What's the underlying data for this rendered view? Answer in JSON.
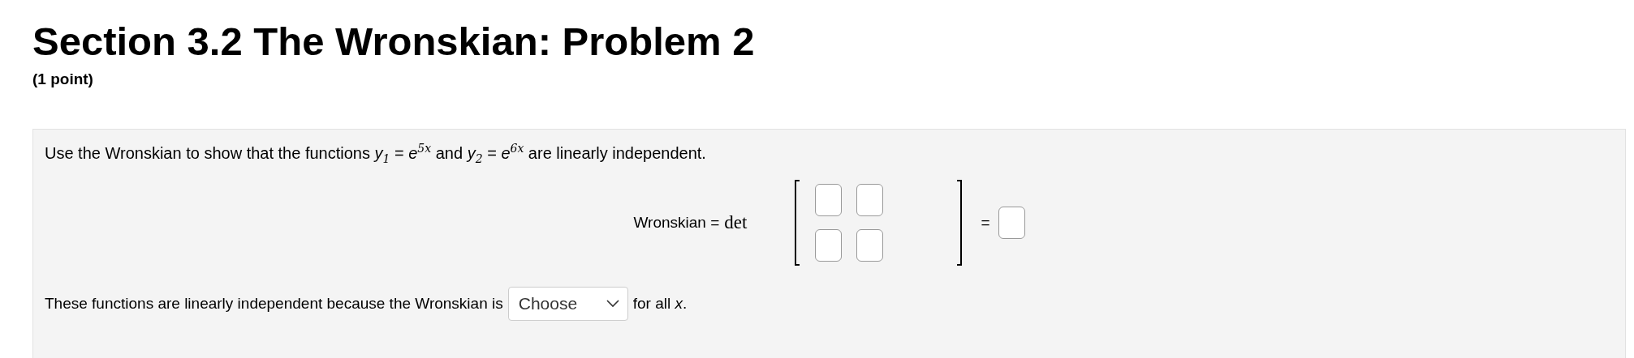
{
  "title": "Section 3.2 The Wronskian: Problem 2",
  "points": "(1 point)",
  "problem": {
    "statement": "Use the Wronskian to show that the functions *y*$_{1}$ = *e*$^{5x}$ and *y*$_{2}$ = *e*$^{6x}$ are linearly independent.",
    "equation": {
      "label": "Wronskian =",
      "operator": "det",
      "matrix_rows": [
        {
          "cells": [
            {
              "kind": "answer"
            },
            {
              "kind": "answer"
            }
          ]
        },
        {
          "cells": [
            {
              "kind": "answer"
            },
            {
              "kind": "answer"
            }
          ]
        }
      ],
      "equals": "=",
      "result": {
        "kind": "answer"
      }
    },
    "conclusion": {
      "before": "These functions are linearly independent because the Wronskian is",
      "dropdown": "Choose",
      "after": "for all *x*."
    }
  }
}
